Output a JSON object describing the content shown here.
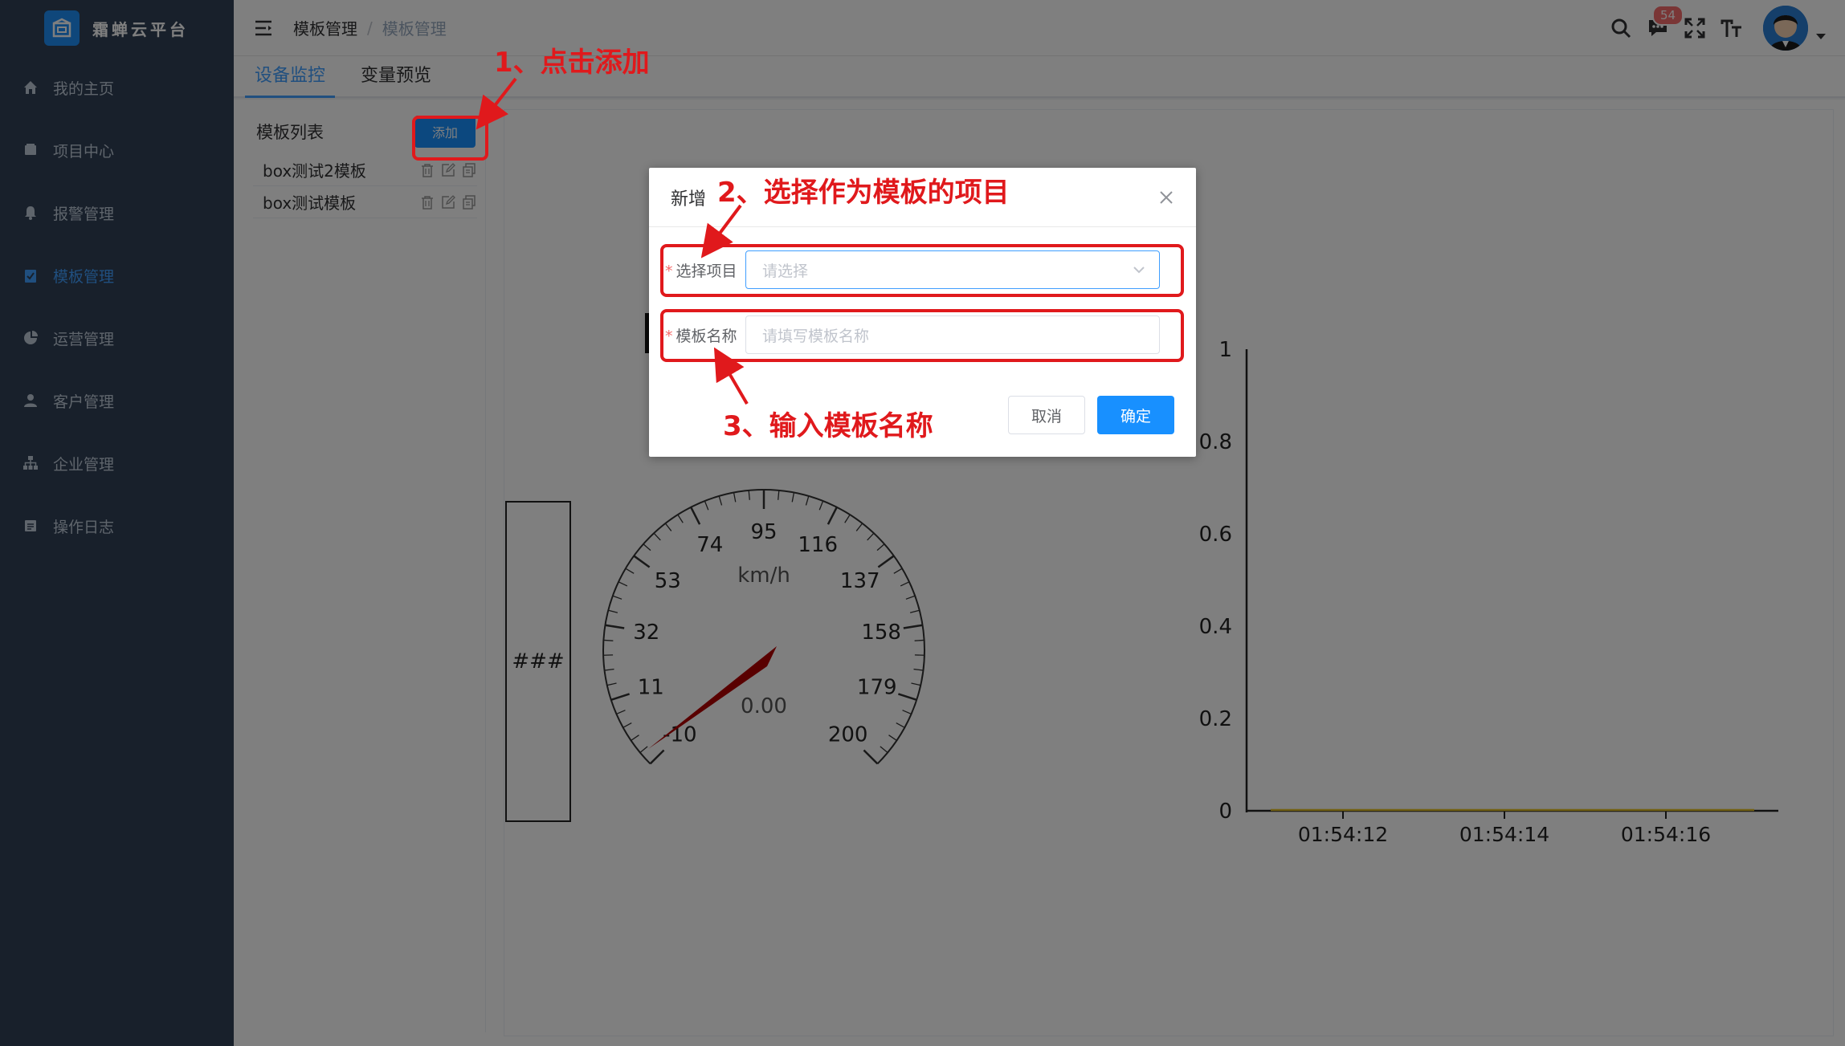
{
  "app": {
    "title": "霜蝉云平台"
  },
  "sidebar": {
    "items": [
      {
        "label": "我的主页",
        "icon": "home-icon"
      },
      {
        "label": "项目中心",
        "icon": "folder-icon"
      },
      {
        "label": "报警管理",
        "icon": "bell-icon"
      },
      {
        "label": "模板管理",
        "icon": "clipboard-icon",
        "active": true
      },
      {
        "label": "运营管理",
        "icon": "pie-chart-icon"
      },
      {
        "label": "客户管理",
        "icon": "user-icon"
      },
      {
        "label": "企业管理",
        "icon": "org-chart-icon"
      },
      {
        "label": "操作日志",
        "icon": "log-icon"
      }
    ]
  },
  "header": {
    "breadcrumb": [
      "模板管理",
      "模板管理"
    ],
    "notification_count": "54"
  },
  "tabs": [
    {
      "label": "设备监控",
      "active": true
    },
    {
      "label": "变量预览",
      "active": false
    }
  ],
  "template_panel": {
    "title": "模板列表",
    "add_label": "添加",
    "items": [
      "box测试2模板",
      "box测试模板"
    ]
  },
  "preview": {
    "box_text": "###",
    "speedometer": {
      "unit": "km/h",
      "value_text": "0.00",
      "ticks": [
        "-10",
        "11",
        "32",
        "53",
        "74",
        "95",
        "116",
        "137",
        "158",
        "179",
        "200"
      ]
    },
    "line_chart": {
      "y_ticks": [
        "0",
        "0.2",
        "0.4",
        "0.6",
        "0.8",
        "1"
      ],
      "x_ticks": [
        "01:54:12",
        "01:54:14",
        "01:54:16"
      ]
    }
  },
  "chart_data": {
    "type": "line",
    "x": [
      "01:54:12",
      "01:54:14",
      "01:54:16"
    ],
    "series": [
      {
        "values": [
          0,
          0,
          0
        ]
      }
    ],
    "ylim": [
      0,
      1
    ],
    "grid": false
  },
  "dialog": {
    "title": "新增",
    "project_label": "选择项目",
    "project_placeholder": "请选择",
    "name_label": "模板名称",
    "name_placeholder": "请填写模板名称",
    "cancel_label": "取消",
    "ok_label": "确定"
  },
  "annotations": {
    "step1": "1、点击添加",
    "step2": "2、选择作为模板的项目",
    "step3": "3、输入模板名称"
  },
  "colors": {
    "primary": "#1890ff",
    "sidebar": "#304156",
    "annotation": "#e0191c"
  }
}
